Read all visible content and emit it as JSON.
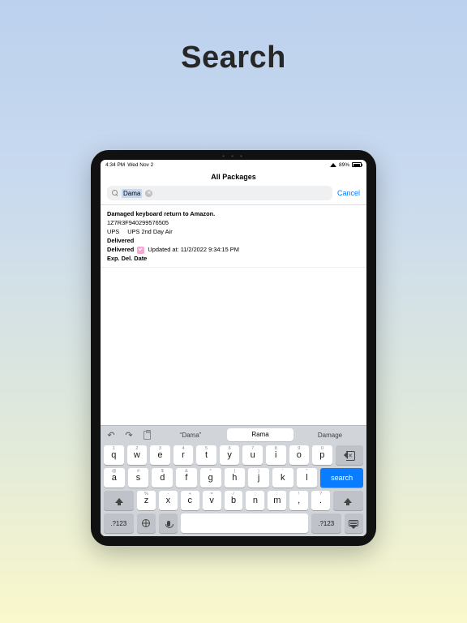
{
  "hero": {
    "title": "Search"
  },
  "status": {
    "time": "4:34 PM",
    "date": "Wed Nov 2",
    "battery_pct": "89%",
    "battery_fill_pct": 89
  },
  "navbar": {
    "title": "All Packages"
  },
  "search": {
    "query": "Dama",
    "cancel": "Cancel"
  },
  "result": {
    "title": "Damaged keyboard return to Amazon.",
    "tracking": "1Z7R3F940299576505",
    "carrier": "UPS",
    "service": "UPS 2nd Day Air",
    "status_label": "Delivered",
    "delivered_label": "Delivered",
    "updated_label": "Updated at:",
    "updated_value": "11/2/2022 9:34:15 PM",
    "exp_label": "Exp. Del. Date"
  },
  "candidates": {
    "quoted_prefix": "“",
    "quoted_value": "Dama",
    "quoted_suffix": "”",
    "pill": "Rama",
    "plain": "Damage"
  },
  "keyboard": {
    "row1": [
      {
        "main": "q",
        "hint": "1"
      },
      {
        "main": "w",
        "hint": "2"
      },
      {
        "main": "e",
        "hint": "3"
      },
      {
        "main": "r",
        "hint": "4"
      },
      {
        "main": "t",
        "hint": "5"
      },
      {
        "main": "y",
        "hint": "6"
      },
      {
        "main": "u",
        "hint": "7"
      },
      {
        "main": "i",
        "hint": "8"
      },
      {
        "main": "o",
        "hint": "9"
      },
      {
        "main": "p",
        "hint": "0"
      }
    ],
    "row2": [
      {
        "main": "a",
        "hint": "@"
      },
      {
        "main": "s",
        "hint": "#"
      },
      {
        "main": "d",
        "hint": "$"
      },
      {
        "main": "f",
        "hint": "&"
      },
      {
        "main": "g",
        "hint": "*"
      },
      {
        "main": "h",
        "hint": "("
      },
      {
        "main": "j",
        "hint": ")"
      },
      {
        "main": "k",
        "hint": "'"
      },
      {
        "main": "l",
        "hint": "\""
      }
    ],
    "row3": [
      {
        "main": "z",
        "hint": "%"
      },
      {
        "main": "x",
        "hint": "-"
      },
      {
        "main": "c",
        "hint": "+"
      },
      {
        "main": "v",
        "hint": "="
      },
      {
        "main": "b",
        "hint": "/"
      },
      {
        "main": "n",
        "hint": ";"
      },
      {
        "main": "m",
        "hint": ":"
      },
      {
        "main": ",",
        "hint": "!"
      },
      {
        "main": ".",
        "hint": "?"
      }
    ],
    "search_label": "search",
    "sym_label": ".?123"
  }
}
